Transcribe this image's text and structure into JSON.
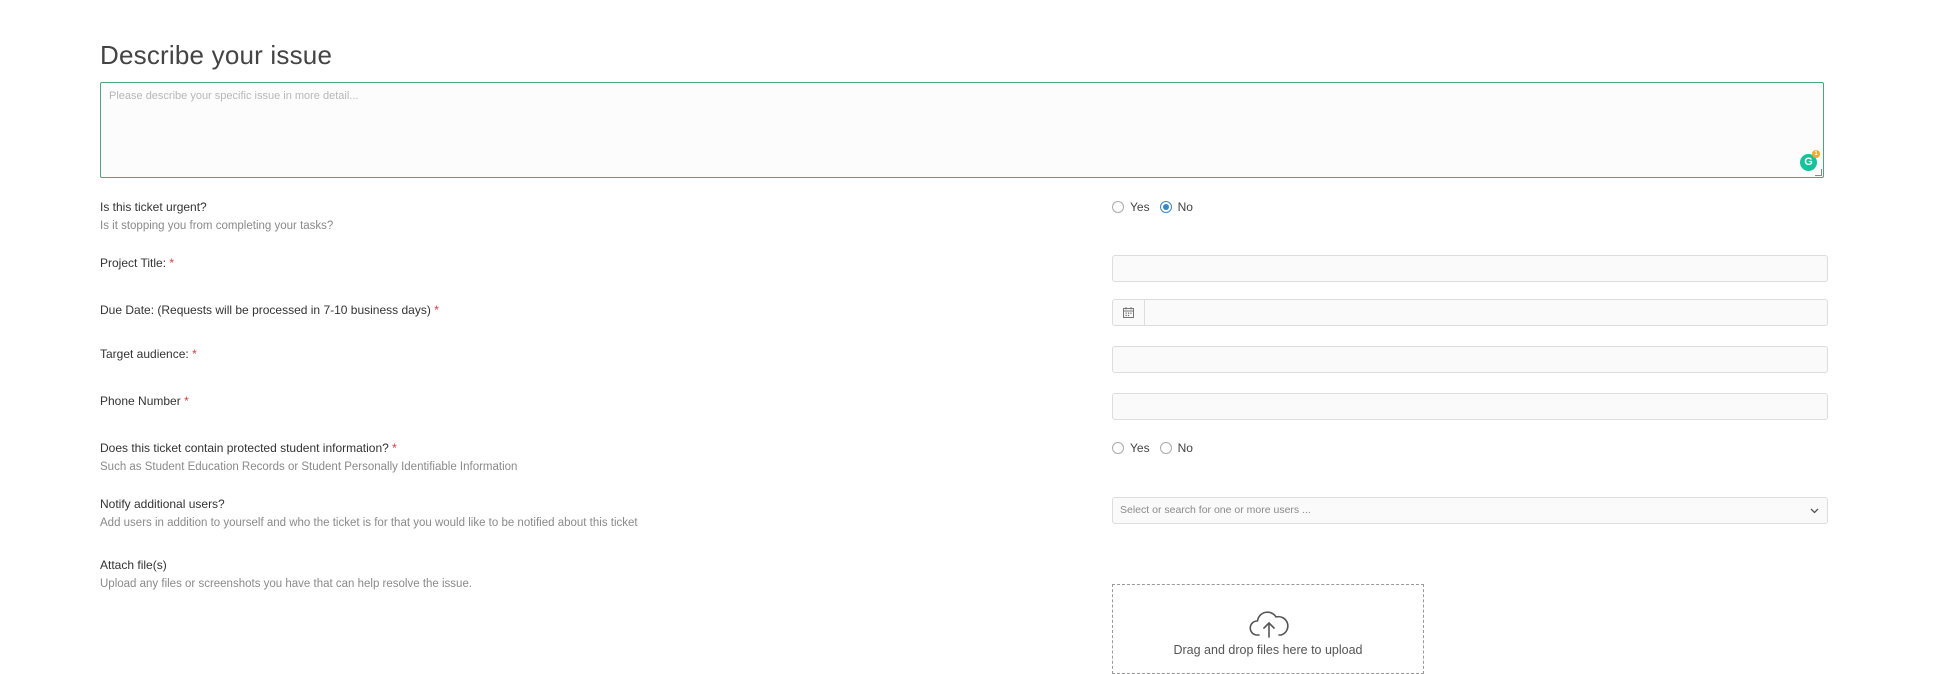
{
  "heading": "Describe your issue",
  "description": {
    "placeholder": "Please describe your specific issue in more detail...",
    "value": "",
    "grammarly_icon": "grammarly-icon",
    "grammarly_badge": "1"
  },
  "urgent": {
    "label": "Is this ticket urgent?",
    "sub": "Is it stopping you from completing your tasks?",
    "yes_label": "Yes",
    "no_label": "No",
    "selected": "No"
  },
  "project_title": {
    "label": "Project Title:",
    "required_mark": "*",
    "value": ""
  },
  "due_date": {
    "label": "Due Date: (Requests will be processed in 7-10 business days)",
    "required_mark": "*",
    "value": "",
    "icon": "calendar-icon"
  },
  "target_audience": {
    "label": "Target audience:",
    "required_mark": "*",
    "value": ""
  },
  "phone": {
    "label": "Phone Number",
    "required_mark": "*",
    "value": ""
  },
  "protected": {
    "label": "Does this ticket contain protected student information?",
    "required_mark": "*",
    "sub": "Such as Student Education Records or Student Personally Identifiable Information",
    "yes_label": "Yes",
    "no_label": "No",
    "selected": ""
  },
  "notify": {
    "label": "Notify additional users?",
    "sub": "Add users in addition to yourself and who the ticket is for that you would like to be notified about this ticket",
    "placeholder": "Select or search for one or more users ..."
  },
  "attach": {
    "label": "Attach file(s)",
    "sub": "Upload any files or screenshots you have that can help resolve the issue.",
    "dropzone_text": "Drag and drop files here to upload",
    "icon": "cloud-upload-icon"
  },
  "colors": {
    "accent": "#3a87c8",
    "focus_border": "#4ba67a",
    "required": "#e03a3a"
  }
}
